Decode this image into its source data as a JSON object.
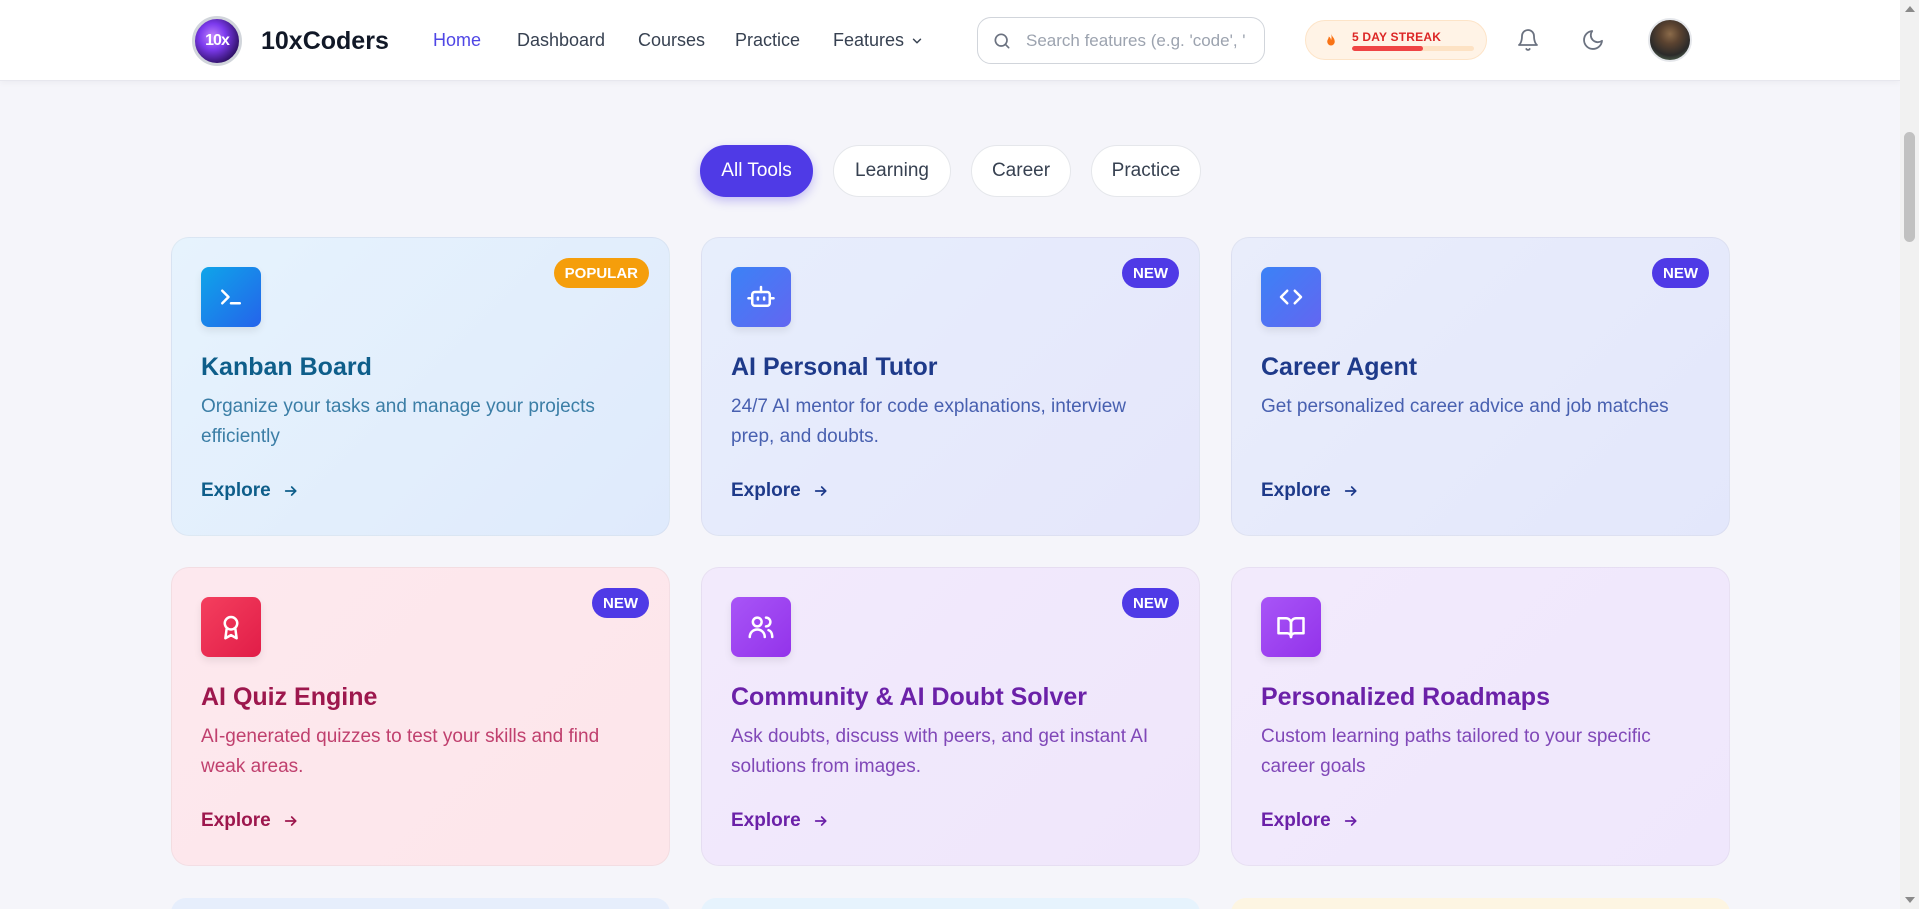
{
  "header": {
    "logo_text": "10x",
    "brand": "10xCoders",
    "nav": [
      {
        "label": "Home",
        "active": true
      },
      {
        "label": "Dashboard"
      },
      {
        "label": "Courses"
      },
      {
        "label": "Practice"
      },
      {
        "label": "Features"
      }
    ],
    "search_placeholder": "Search features (e.g. 'code', '",
    "streak_label": "5 DAY STREAK",
    "streak_progress": 0.58,
    "icons": [
      "flame-icon",
      "bell-icon",
      "moon-icon",
      "search-icon",
      "chevron-down-icon"
    ]
  },
  "filters": [
    "All Tools",
    "Learning",
    "Career",
    "Practice"
  ],
  "active_filter": "All Tools",
  "cards": [
    {
      "title": "Kanban Board",
      "desc": "Organize your tasks and manage your projects efficiently",
      "badge": "POPULAR",
      "icon": "terminal-icon",
      "cta": "Explore",
      "accent": "#0e5e8a",
      "badge_color": "#f59e0b"
    },
    {
      "title": "AI Personal Tutor",
      "desc": "24/7 AI mentor for code explanations, interview prep, and doubts.",
      "badge": "NEW",
      "icon": "robot-icon",
      "cta": "Explore",
      "accent": "#1e3a8a",
      "badge_color": "#4f3ae6"
    },
    {
      "title": "Career Agent",
      "desc": "Get personalized career advice and job matches",
      "badge": "NEW",
      "icon": "code-icon",
      "cta": "Explore",
      "accent": "#1e3a8a",
      "badge_color": "#4f3ae6"
    },
    {
      "title": "AI Quiz Engine",
      "desc": "AI-generated quizzes to test your skills and find weak areas.",
      "badge": "NEW",
      "icon": "award-icon",
      "cta": "Explore",
      "accent": "#9d174d",
      "badge_color": "#4f3ae6"
    },
    {
      "title": "Community & AI Doubt Solver",
      "desc": "Ask doubts, discuss with peers, and get instant AI solutions from images.",
      "badge": "NEW",
      "icon": "users-icon",
      "cta": "Explore",
      "accent": "#6b21a8",
      "badge_color": "#4f3ae6"
    },
    {
      "title": "Personalized Roadmaps",
      "desc": "Custom learning paths tailored to your specific career goals",
      "badge": "",
      "icon": "book-open-icon",
      "cta": "Explore",
      "accent": "#6b21a8",
      "badge_color": ""
    }
  ],
  "colors": {
    "primary": "#4f3ae6",
    "page_bg": "#f5f5fa"
  }
}
